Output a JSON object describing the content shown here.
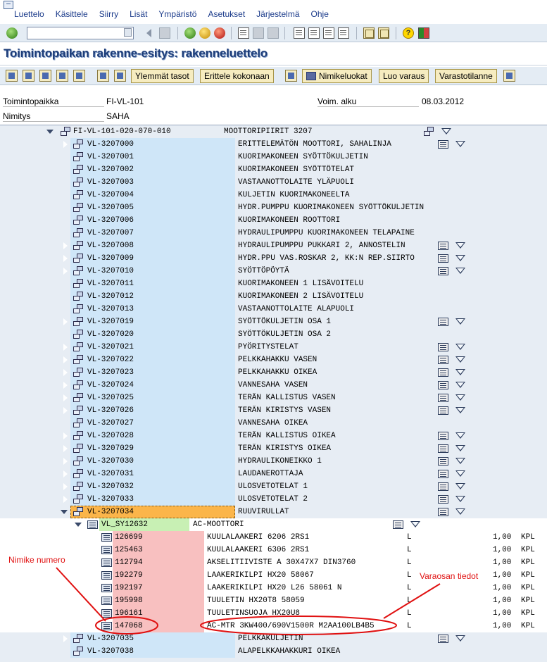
{
  "menu": {
    "items": [
      "Luettelo",
      "Käsittele",
      "Siirry",
      "Lisät",
      "Ympäristö",
      "Asetukset",
      "Järjestelmä",
      "Ohje"
    ]
  },
  "system_toolbar": {
    "command_field_value": ""
  },
  "title": "Toimintopaikan rakenne-esitys: rakenneluettelo",
  "app_toolbar": {
    "buttons": [
      "Ylemmät tasot",
      "Erittele kokonaan",
      "Nimikeluokat",
      "Luo varaus",
      "Varastotilanne"
    ]
  },
  "header": {
    "location_label": "Toimintopaikka",
    "location_value": "FI-VL-101",
    "valid_from_label": "Voim. alku",
    "valid_from_value": "08.03.2012",
    "name_label": "Nimitys",
    "name_value": "SAHA"
  },
  "tree": {
    "root": {
      "code": "FI-VL-101-020-070-010",
      "description": "MOOTTORIPIIRIT 3207"
    },
    "nodes": [
      {
        "code": "VL-3207000",
        "description": "ERITTELEMÄTÖN MOOTTORI, SAHALINJA",
        "expandable": true,
        "has_bom": true
      },
      {
        "code": "VL-3207001",
        "description": "KUORIMAKONEEN SYÖTTÖKULJETIN",
        "expandable": false,
        "has_bom": false
      },
      {
        "code": "VL-3207002",
        "description": "KUORIMAKONEEN SYÖTTÖTELAT",
        "expandable": false,
        "has_bom": false
      },
      {
        "code": "VL-3207003",
        "description": "VASTAANOTTOLAITE YLÄPUOLI",
        "expandable": false,
        "has_bom": false
      },
      {
        "code": "VL-3207004",
        "description": "KULJETIN KUORIMAKONEELTA",
        "expandable": false,
        "has_bom": false
      },
      {
        "code": "VL-3207005",
        "description": "HYDR.PUMPPU KUORIMAKONEEN SYÖTTÖKULJETIN",
        "expandable": false,
        "has_bom": false
      },
      {
        "code": "VL-3207006",
        "description": "KUORIMAKONEEN ROOTTORI",
        "expandable": false,
        "has_bom": false
      },
      {
        "code": "VL-3207007",
        "description": "HYDRAULIPUMPPU KUORIMAKONEEN TELAPAINE",
        "expandable": false,
        "has_bom": false
      },
      {
        "code": "VL-3207008",
        "description": "HYDRAULIPUMPPU PUKKARI 2, ANNOSTELIN",
        "expandable": true,
        "has_bom": true
      },
      {
        "code": "VL-3207009",
        "description": "HYDR.PPU VAS.ROSKAR 2, KK:N REP.SIIRTO",
        "expandable": true,
        "has_bom": true
      },
      {
        "code": "VL-3207010",
        "description": "SYÖTTÖPÖYTÄ",
        "expandable": true,
        "has_bom": true
      },
      {
        "code": "VL-3207011",
        "description": "KUORIMAKONEEN 1 LISÄVOITELU",
        "expandable": false,
        "has_bom": false
      },
      {
        "code": "VL-3207012",
        "description": "KUORIMAKONEEN 2 LISÄVOITELU",
        "expandable": false,
        "has_bom": false
      },
      {
        "code": "VL-3207013",
        "description": "VASTAANOTTOLAITE ALAPUOLI",
        "expandable": false,
        "has_bom": false
      },
      {
        "code": "VL-3207019",
        "description": "SYÖTTÖKULJETIN OSA 1",
        "expandable": true,
        "has_bom": true
      },
      {
        "code": "VL-3207020",
        "description": "SYÖTTÖKULJETIN OSA 2",
        "expandable": false,
        "has_bom": false
      },
      {
        "code": "VL-3207021",
        "description": "PYÖRITYSTELAT",
        "expandable": true,
        "has_bom": true
      },
      {
        "code": "VL-3207022",
        "description": "PELKKAHAKKU VASEN",
        "expandable": true,
        "has_bom": true
      },
      {
        "code": "VL-3207023",
        "description": "PELKKAHAKKU OIKEA",
        "expandable": true,
        "has_bom": true
      },
      {
        "code": "VL-3207024",
        "description": "VANNESAHA VASEN",
        "expandable": true,
        "has_bom": true
      },
      {
        "code": "VL-3207025",
        "description": "TERÄN KALLISTUS VASEN",
        "expandable": true,
        "has_bom": true
      },
      {
        "code": "VL-3207026",
        "description": "TERÄN KIRISTYS VASEN",
        "expandable": true,
        "has_bom": true
      },
      {
        "code": "VL-3207027",
        "description": "VANNESAHA OIKEA",
        "expandable": false,
        "has_bom": false
      },
      {
        "code": "VL-3207028",
        "description": "TERÄN KALLISTUS OIKEA",
        "expandable": true,
        "has_bom": true
      },
      {
        "code": "VL-3207029",
        "description": "TERÄN KIRISTYS OIKEA",
        "expandable": true,
        "has_bom": true
      },
      {
        "code": "VL-3207030",
        "description": "HYDRAULIKONEIKKO 1",
        "expandable": true,
        "has_bom": true
      },
      {
        "code": "VL-3207031",
        "description": "LAUDANEROTTAJA",
        "expandable": true,
        "has_bom": true
      },
      {
        "code": "VL-3207032",
        "description": "ULOSVETOTELAT 1",
        "expandable": true,
        "has_bom": true
      },
      {
        "code": "VL-3207033",
        "description": "ULOSVETOTELAT 2",
        "expandable": true,
        "has_bom": true
      },
      {
        "code": "VL-3207034",
        "description": "RUUVIRULLAT",
        "expandable": true,
        "expanded": true,
        "has_bom": true,
        "selected": true
      }
    ],
    "bom_header": {
      "code": "VL_SY12632",
      "description": "AC-MOOTTORI"
    },
    "bom_items": [
      {
        "number": "126699",
        "description": "KUULALAAKERI 6206 2RS1",
        "category": "L",
        "quantity": "1,00",
        "unit": "KPL"
      },
      {
        "number": "125463",
        "description": "KUULALAAKERI 6306 2RS1",
        "category": "L",
        "quantity": "1,00",
        "unit": "KPL"
      },
      {
        "number": "112794",
        "description": "AKSELITIIVISTE A 30X47X7 DIN3760",
        "category": "L",
        "quantity": "1,00",
        "unit": "KPL"
      },
      {
        "number": "192279",
        "description": "LAAKERIKILPI HX20 58067",
        "category": "L",
        "quantity": "1,00",
        "unit": "KPL"
      },
      {
        "number": "192197",
        "description": "LAAKERIKILPI HX20 L26 58061 N",
        "category": "L",
        "quantity": "1,00",
        "unit": "KPL"
      },
      {
        "number": "195998",
        "description": "TUULETIN HX20T8 58059",
        "category": "L",
        "quantity": "1,00",
        "unit": "KPL"
      },
      {
        "number": "196161",
        "description": "TUULETINSUOJA HX20U8",
        "category": "L",
        "quantity": "1,00",
        "unit": "KPL"
      },
      {
        "number": "147068",
        "description": "AC-MTR 3KW400/690V1500R M2AA100LB4B5",
        "category": "L",
        "quantity": "1,00",
        "unit": "KPL"
      }
    ],
    "after_nodes": [
      {
        "code": "VL-3207035",
        "description": "PELKKAKULJETIN",
        "expandable": true,
        "has_bom": true
      },
      {
        "code": "VL-3207038",
        "description": "ALAPELKKAHAKKURI OIKEA",
        "expandable": false,
        "has_bom": false
      }
    ]
  },
  "annotations": {
    "left_label": "Nimike numero",
    "right_label": "Varaosan tiedot",
    "color": "#e01010"
  }
}
